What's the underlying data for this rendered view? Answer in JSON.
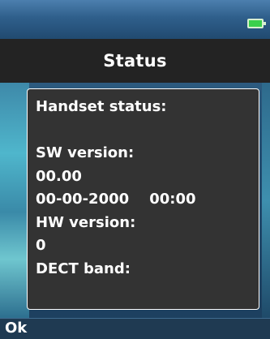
{
  "header": {
    "battery_icon": "battery-full-icon",
    "battery_color": "#3ad04c"
  },
  "title": "Status",
  "panel": {
    "lines": [
      "Handset status:",
      "",
      "SW version:",
      "00.00",
      "00-00-2000    00:00",
      "HW version:",
      "0",
      "DECT band:"
    ]
  },
  "softkeys": {
    "left_label": "Ok"
  },
  "colors": {
    "title_bar": "#232323",
    "panel_bg": "#333333",
    "text": "#ffffff"
  }
}
